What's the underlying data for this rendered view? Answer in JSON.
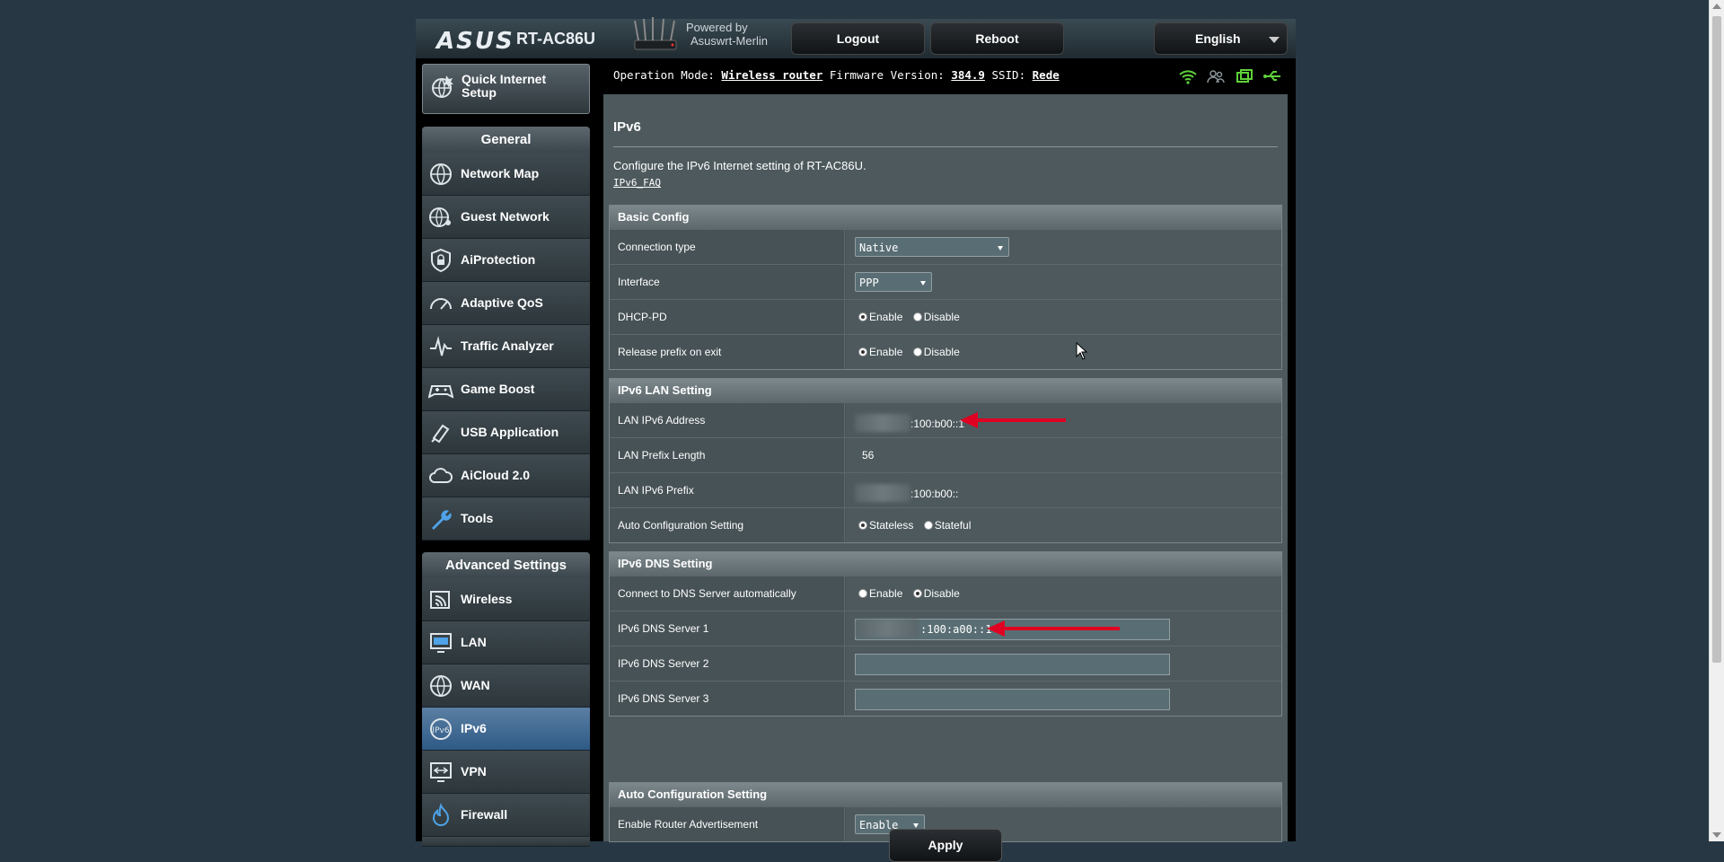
{
  "header": {
    "logo": "ASUS",
    "model": "RT-AC86U",
    "powered_by_line1": "Powered by",
    "powered_by_line2": "Asuswrt-Merlin",
    "logout_label": "Logout",
    "reboot_label": "Reboot",
    "language": "English"
  },
  "sidebar": {
    "quick_setup_line1": "Quick Internet",
    "quick_setup_line2": "Setup",
    "general_title": "General",
    "general_items": [
      {
        "label": "Network Map",
        "icon": "globe-icon"
      },
      {
        "label": "Guest Network",
        "icon": "globe-people-icon"
      },
      {
        "label": "AiProtection",
        "icon": "shield-lock-icon"
      },
      {
        "label": "Adaptive QoS",
        "icon": "speedometer-icon"
      },
      {
        "label": "Traffic Analyzer",
        "icon": "pulse-icon"
      },
      {
        "label": "Game Boost",
        "icon": "gamepad-icon"
      },
      {
        "label": "USB Application",
        "icon": "puzzle-icon"
      },
      {
        "label": "AiCloud 2.0",
        "icon": "cloud-icon"
      },
      {
        "label": "Tools",
        "icon": "wrench-icon"
      }
    ],
    "advanced_title": "Advanced Settings",
    "advanced_items": [
      {
        "label": "Wireless",
        "icon": "wifi-icon"
      },
      {
        "label": "LAN",
        "icon": "monitor-icon"
      },
      {
        "label": "WAN",
        "icon": "globe-icon"
      },
      {
        "label": "IPv6",
        "icon": "ipv6-globe-icon",
        "active": true
      },
      {
        "label": "VPN",
        "icon": "vpn-monitor-icon"
      },
      {
        "label": "Firewall",
        "icon": "fire-icon"
      }
    ]
  },
  "status": {
    "operation_mode_label": "Operation Mode:",
    "operation_mode_value": "Wireless router",
    "firmware_label": "Firmware Version:",
    "firmware_value": "384.9",
    "ssid_label": "SSID:",
    "ssid_value": "Rede"
  },
  "page": {
    "title": "IPv6",
    "description": "Configure the IPv6 Internet setting of RT-AC86U.",
    "faq_link": "IPv6_FAQ"
  },
  "basic_config": {
    "title": "Basic Config",
    "connection_type_label": "Connection type",
    "connection_type_value": "Native",
    "interface_label": "Interface",
    "interface_value": "PPP",
    "dhcp_pd_label": "DHCP-PD",
    "release_prefix_label": "Release prefix on exit",
    "enable_label": "Enable",
    "disable_label": "Disable"
  },
  "lan_setting": {
    "title": "IPv6 LAN Setting",
    "address_label": "LAN IPv6 Address",
    "address_value": ":100:b00::1",
    "prefix_length_label": "LAN Prefix Length",
    "prefix_length_value": "56",
    "prefix_label": "LAN IPv6 Prefix",
    "prefix_value": ":100:b00::",
    "autoconf_label": "Auto Configuration Setting",
    "stateless_label": "Stateless",
    "stateful_label": "Stateful"
  },
  "dns_setting": {
    "title": "IPv6 DNS Setting",
    "auto_label": "Connect to DNS Server automatically",
    "enable_label": "Enable",
    "disable_label": "Disable",
    "server1_label": "IPv6 DNS Server 1",
    "server1_value": ":100:a00::1",
    "server2_label": "IPv6 DNS Server 2",
    "server2_value": "",
    "server3_label": "IPv6 DNS Server 3",
    "server3_value": ""
  },
  "autoconf_section": {
    "title": "Auto Configuration Setting",
    "router_adv_label": "Enable Router Advertisement",
    "router_adv_value": "Enable"
  },
  "apply_label": "Apply",
  "colors": {
    "background": "#273844",
    "panel": "#4d595d",
    "active_menu": "#4a6f95",
    "annotation_arrow": "#e00022",
    "status_icon_green": "#5fd13a"
  }
}
